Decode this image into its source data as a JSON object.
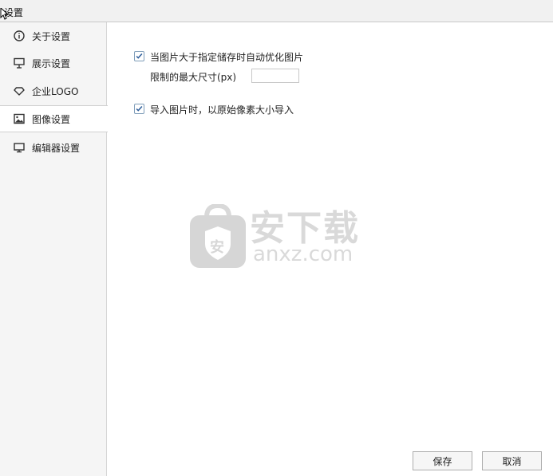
{
  "window": {
    "title": "设置"
  },
  "sidebar": {
    "items": [
      {
        "label": "关于设置",
        "icon": "info-icon"
      },
      {
        "label": "展示设置",
        "icon": "presentation-icon"
      },
      {
        "label": "企业LOGO",
        "icon": "diamond-icon"
      },
      {
        "label": "图像设置",
        "icon": "image-icon",
        "selected": true
      },
      {
        "label": "编辑器设置",
        "icon": "monitor-icon"
      }
    ]
  },
  "image_settings": {
    "auto_optimize": {
      "label": "当图片大于指定储存时自动优化图片",
      "checked": true
    },
    "max_size": {
      "label": "限制的最大尺寸(px)",
      "value": ""
    },
    "import_original": {
      "label": "导入图片时，以原始像素大小导入",
      "checked": true
    }
  },
  "watermark": {
    "text_cn": "安下载",
    "text_en": "anxz.com",
    "shield_char": "安"
  },
  "footer": {
    "save_label": "保存",
    "cancel_label": "取消"
  },
  "colors": {
    "checkbox_border": "#7f9db9",
    "checkmark": "#2d5d9a",
    "watermark": "#d9d9d9"
  }
}
